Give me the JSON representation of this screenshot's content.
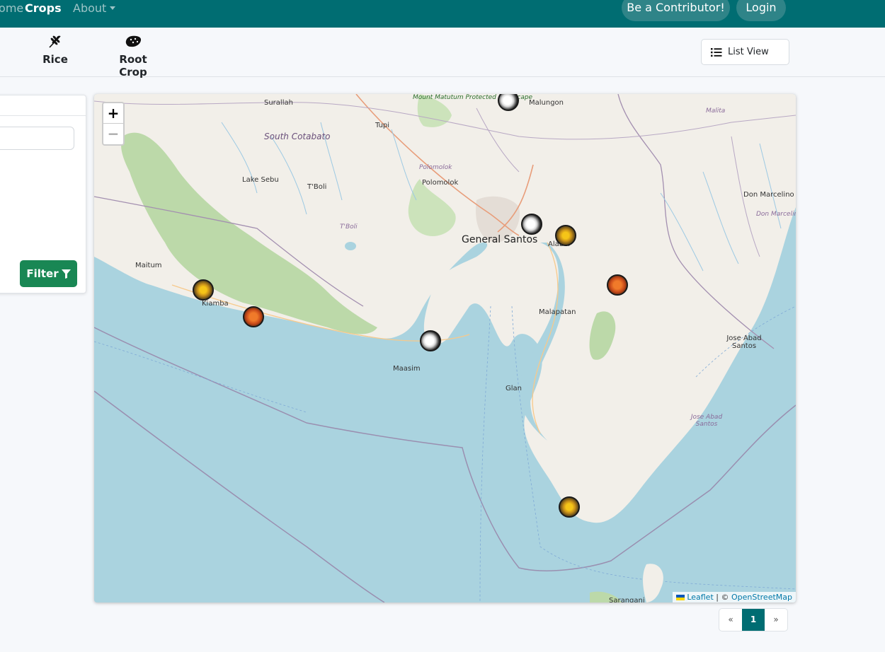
{
  "navbar": {
    "home_label": "Home",
    "crops_label": "Crops",
    "about_label": "About",
    "contributor_label": "Be a Contributor!",
    "login_label": "Login",
    "bg_color": "#006d72"
  },
  "categories": [
    {
      "label": "Rice",
      "icon": "rice-grain-icon"
    },
    {
      "label": "Root Crop",
      "icon": "potato-icon"
    }
  ],
  "view_toggle": {
    "label": "List View",
    "icon": "list-icon"
  },
  "filter": {
    "button_label": "Filter",
    "icon": "funnel-icon"
  },
  "map": {
    "place_labels": {
      "surallah": "Surallah",
      "tupi": "Tupi",
      "mount_matutum": "Mount Matutum Protected Landscape",
      "malungon": "Malungon",
      "malita": "Malita",
      "south_cotabato": "South Cotabato",
      "lake_sebu": "Lake Sebu",
      "tboli": "T'Boli",
      "tboli_region": "T'Boli",
      "polomolok_region": "Polomolok",
      "polomolok": "Polomolok",
      "don_marcelino": "Don Marcelino",
      "don_marcelino_region": "Don Marcelino",
      "general_santos": "General Santos",
      "alabel": "Alabel",
      "maitum": "Maitum",
      "kiamba": "Kiamba",
      "malapatan": "Malapatan",
      "jose_abad_santos": "Jose Abad Santos",
      "jose_abad_santos_region": "Jose Abad Santos",
      "maasim": "Maasim",
      "glan": "Glan",
      "sarangani": "Sarangani"
    },
    "zoom_in": "+",
    "zoom_out": "−",
    "attribution": {
      "leaflet": "Leaflet",
      "separator": " | © ",
      "osm": "OpenStreetMap"
    },
    "markers": [
      {
        "crop": "Rice"
      },
      {
        "crop": "Rice"
      },
      {
        "crop": "Rice"
      },
      {
        "crop": "Root Crop"
      },
      {
        "crop": "Root Crop"
      },
      {
        "crop": "Root Crop"
      },
      {
        "crop": "Root Crop"
      },
      {
        "crop": "Root Crop"
      }
    ]
  },
  "pagination": {
    "prev": "«",
    "current": "1",
    "next": "»"
  }
}
